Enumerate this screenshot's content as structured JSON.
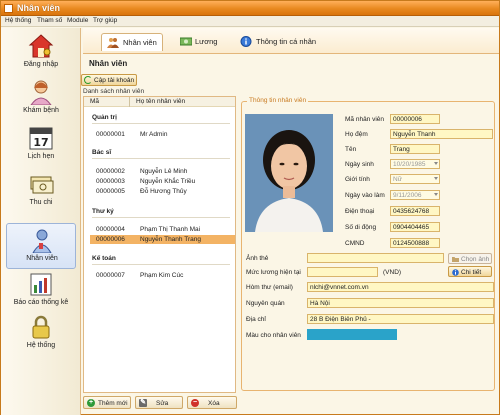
{
  "window": {
    "title": "Nhân viên"
  },
  "menu": [
    "Hệ thống",
    "Tham số",
    "Module",
    "Trợ giúp"
  ],
  "nav": [
    {
      "label": "Đăng nhập",
      "icon": "house-key-icon"
    },
    {
      "label": "Khám bệnh",
      "icon": "doctor-icon"
    },
    {
      "label": "Lịch hẹn",
      "icon": "calendar-icon"
    },
    {
      "label": "Thu chi",
      "icon": "money-icon"
    },
    {
      "label": "Nhân viên",
      "icon": "employee-icon",
      "active": true
    },
    {
      "label": "Báo cáo thống kê",
      "icon": "report-chart-icon"
    },
    {
      "label": "Hệ thống",
      "icon": "lock-icon"
    }
  ],
  "tabs": [
    {
      "label": "Nhân viên",
      "icon": "people-icon",
      "active": true
    },
    {
      "label": "Lương",
      "icon": "cash-icon"
    },
    {
      "label": "Thông tin cá nhân",
      "icon": "globe-info-icon"
    }
  ],
  "heading": "Nhân viên",
  "refresh_label": "Cập tải khoản",
  "list_label": "Danh sách nhân viên",
  "list_columns": [
    "Mã",
    "Họ tên nhân viên"
  ],
  "groups": [
    {
      "name": "Quản trị",
      "rows": [
        {
          "code": "00000001",
          "name": "Mr Admin"
        }
      ]
    },
    {
      "name": "Bác sĩ",
      "rows": [
        {
          "code": "00000002",
          "name": "Nguyễn Lê Minh"
        },
        {
          "code": "00000003",
          "name": "Nguyễn Khắc Triều"
        },
        {
          "code": "00000005",
          "name": "Đỗ Hương Thủy"
        }
      ]
    },
    {
      "name": "Thư ký",
      "rows": [
        {
          "code": "00000004",
          "name": "Phạm Thị Thanh Mai"
        },
        {
          "code": "00000006",
          "name": "Nguyễn Thanh Trang",
          "selected": true
        }
      ]
    },
    {
      "name": "Kế toán",
      "rows": [
        {
          "code": "00000007",
          "name": "Phạm Kim Cúc"
        }
      ]
    }
  ],
  "buttons": {
    "add": "Thêm mới",
    "edit": "Sửa",
    "delete": "Xóa"
  },
  "info": {
    "title": "Thông tin nhân viên",
    "labels": {
      "code": "Mã nhân viên",
      "lastname": "Họ đệm",
      "firstname": "Tên",
      "birth": "Ngày sinh",
      "gender": "Giới tính",
      "joined": "Ngày vào làm",
      "phone": "Điện thoại",
      "mobile": "Số di động",
      "cmnd": "CMND",
      "photo": "Ảnh thẻ",
      "salary": "Mức lương hiện tại",
      "email": "Hòm thư (email)",
      "hometown": "Nguyên quán",
      "address": "Địa chỉ",
      "color": "Màu cho nhân viên"
    },
    "values": {
      "code": "00000006",
      "lastname": "Nguyễn Thanh",
      "firstname": "Trang",
      "birth": "10/20/1985",
      "gender": "Nữ",
      "joined": "9/11/2006",
      "phone": "0435624768",
      "mobile": "0904404465",
      "cmnd": "0124500888",
      "photo": "",
      "salary": "",
      "salary_unit": "(VND)",
      "email": "nlchi@vnnet.com.vn",
      "hometown": "Hà Nội",
      "address": "28 B Điện Biên Phủ -"
    },
    "choose_photo": "Chọn ảnh",
    "details": "Chi tiết",
    "employee_color": "#2aa3c9"
  }
}
